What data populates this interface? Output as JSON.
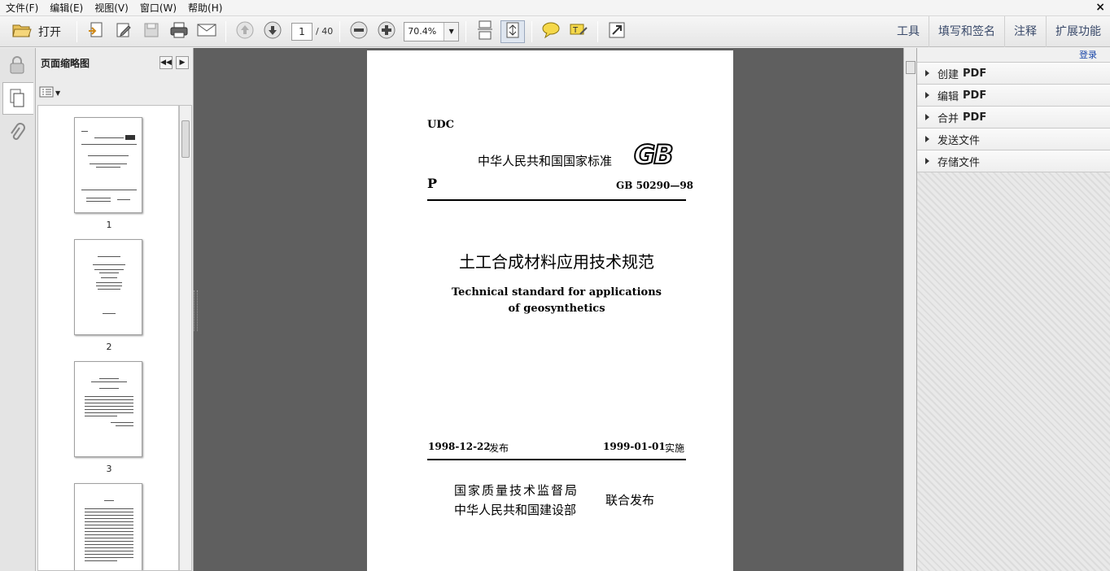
{
  "menu": {
    "items": [
      "文件(F)",
      "编辑(E)",
      "视图(V)",
      "窗口(W)",
      "帮助(H)"
    ],
    "close": "×"
  },
  "toolbar": {
    "open_label": "打开",
    "page_current": "1",
    "page_total": "/ 40",
    "zoom": "70.4%",
    "right_items": [
      "工具",
      "填写和签名",
      "注释",
      "扩展功能"
    ]
  },
  "thumbnails": {
    "title": "页面缩略图",
    "pages": [
      {
        "label": "1"
      },
      {
        "label": "2"
      },
      {
        "label": "3"
      }
    ]
  },
  "document": {
    "udc": "UDC",
    "national_standard": "中华人民共和国国家标准",
    "gb_logo": "GB",
    "category": "P",
    "code": "GB 50290—98",
    "title_cn": "土工合成材料应用技术规范",
    "title_en_line1": "Technical standard for applications",
    "title_en_line2": "of geosynthetics",
    "issue_date": "1998-12-22",
    "issue_word": "发布",
    "impl_date": "1999-01-01",
    "impl_word": "实施",
    "publisher1": "国家质量技术监督局",
    "publisher2": "中华人民共和国建设部",
    "joint_publish": "联合发布"
  },
  "right_panel": {
    "login": "登录",
    "items": [
      {
        "label": "创建",
        "suffix": "PDF"
      },
      {
        "label": "编辑",
        "suffix": "PDF"
      },
      {
        "label": "合并",
        "suffix": "PDF"
      },
      {
        "label": "发送文件",
        "suffix": ""
      },
      {
        "label": "存储文件",
        "suffix": ""
      }
    ]
  }
}
